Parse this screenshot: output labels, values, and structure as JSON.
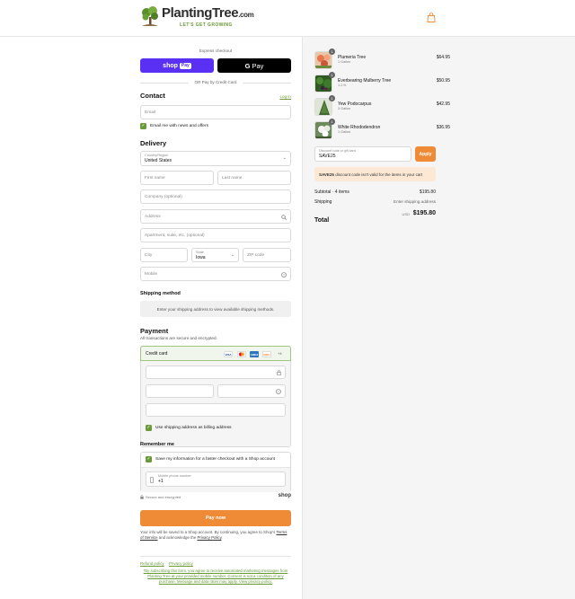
{
  "header": {
    "brand_name": "PlantingTree",
    "brand_domain": ".com",
    "tagline": "LET'S GET GROWING",
    "icons": {
      "logo": "tree-logo-icon",
      "cart": "shopping-bag-icon"
    }
  },
  "express": {
    "label": "Express checkout",
    "shop_pay_label": "shop",
    "shop_pay_badge": "Pay",
    "gpay_g": "G",
    "gpay_label": "Pay",
    "or_label": "OR Pay by Credit Card"
  },
  "contact": {
    "heading": "Contact",
    "login_label": "Log in",
    "email_placeholder": "Email",
    "news_checkbox_label": "Email me with news and offers",
    "news_checked": true
  },
  "delivery": {
    "heading": "Delivery",
    "country_label": "Country/Region",
    "country_value": "United States",
    "first_name_placeholder": "First name",
    "last_name_placeholder": "Last name",
    "company_placeholder": "Company (optional)",
    "address_placeholder": "Address",
    "apartment_placeholder": "Apartment, suite, etc. (optional)",
    "city_placeholder": "City",
    "state_label": "State",
    "state_value": "Iowa",
    "zip_placeholder": "ZIP code",
    "mobile_placeholder": "Mobile"
  },
  "shipping": {
    "heading": "Shipping method",
    "notice": "Enter your shipping address to view available shipping methods."
  },
  "payment": {
    "heading": "Payment",
    "subheading": "All transactions are secure and encrypted.",
    "method_label": "Credit card",
    "brands": [
      "VISA",
      "MC",
      "AMEX",
      "DISC"
    ],
    "more_label": "+4",
    "billing_checkbox_label": "Use shipping address as billing address",
    "billing_checked": true
  },
  "remember": {
    "heading": "Remember me",
    "save_checkbox_label": "Save my information for a faster checkout with a Shop account",
    "save_checked": true,
    "phone_label": "Mobile phone number",
    "phone_value": "+1",
    "secure_label": "Secure and encrypted",
    "shop_logo": "shop"
  },
  "pay_now_label": "Pay now",
  "legal": {
    "line1": "Your info will be saved to a Shop account. By continuing, you agree to Shop's",
    "tos": "Terms of Service",
    "and": "and acknowledge the",
    "privacy": "Privacy Policy",
    "end": "."
  },
  "footer": {
    "refund": "Refund policy",
    "privacy": "Privacy policy",
    "sms_notice": "*By subscribing this form, you agree to receive automated marketing messages from Planting Tree at your provided mobile number. Consent is not a condition of any purchase. Message and data rates may apply. View privacy policy."
  },
  "summary": {
    "items": [
      {
        "name": "Plumeria Tree",
        "size": "1 Gallon",
        "price": "$64.95",
        "qty": "1",
        "color": "#c96b4a"
      },
      {
        "name": "Everbearing Mulberry Tree",
        "size": "1-2 ft.",
        "price": "$50.95",
        "qty": "1",
        "color": "#3f6b2a"
      },
      {
        "name": "Yew Podocarpus",
        "size": "3 Gallon",
        "price": "$42.95",
        "qty": "1",
        "color": "#4d6e3a"
      },
      {
        "name": "White Rhododendron",
        "size": "1 Gallon",
        "price": "$36.95",
        "qty": "1",
        "color": "#8aa07a"
      }
    ],
    "discount_label": "Discount code or gift card",
    "discount_value": "SAVE25",
    "apply_label": "Apply",
    "warning_code": "SAVE25",
    "warning_text": "discount code isn't valid for the items in your cart",
    "subtotal_label": "Subtotal · 4 items",
    "subtotal_value": "$195.80",
    "shipping_label": "Shipping",
    "shipping_value": "Enter shipping address",
    "total_label": "Total",
    "currency": "USD",
    "total_value": "$195.80"
  },
  "colors": {
    "accent_green": "#6a9a3a",
    "orange": "#ef8a36",
    "shop_pay_purple": "#5a31f4"
  }
}
